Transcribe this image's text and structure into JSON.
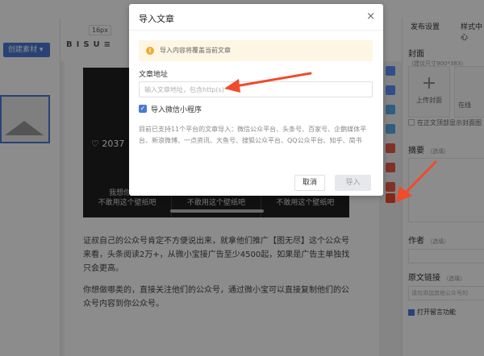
{
  "toolbar": {
    "create_material": "创建素材",
    "font_size": "16px",
    "format_icons": "BISU≡"
  },
  "editor": {
    "caption_top": [
      "我想你们都",
      "不敢用这个"
    ],
    "like_count": "2037",
    "col_caps": [
      [
        "我想你们都",
        "不敢用这个壁纸吧"
      ],
      [
        "我想你们都",
        "不敢用这个壁纸吧"
      ],
      [
        "我想你们都",
        "不敢用这个壁纸吧"
      ]
    ],
    "paragraph1": "证叔自己的公众号肯定不方便说出来，就拿他们推广【图无尽】这个公众号来看，头条阅读2万+，从微小宝接广告至少4500起，如果是广告主单独找只会更高。",
    "paragraph2": "你想做哪类的，直接关注他们的公众号，通过微小宝可以直接复制他们的公众号内容到你公众号。"
  },
  "right_panel": {
    "tab_publish": "发布设置",
    "tab_style": "样式中心",
    "cover_label": "封面",
    "cover_hint": "（建议尺寸900*383）",
    "upload_cover": "上传封面",
    "select_cover": "在线",
    "show_cover_text": "在正文顶部显示封面图",
    "summary_label": "摘要",
    "summary_hint": "（选填）",
    "author_label": "作者",
    "author_hint": "（选填）",
    "source_label": "原文链接",
    "source_hint": "（选填）",
    "source_placeholder": "请勿添加其他公众号的",
    "comment_label": "打开留言功能"
  },
  "modal": {
    "title": "导入文章",
    "close": "×",
    "warning": "导入内容将覆盖当前文章",
    "field_label": "文章地址",
    "field_placeholder": "输入文章地址，包含http(s)",
    "mini_program": "导入微信小程序",
    "support_text": "目前已支持11个平台的文章导入：微信公众平台、头条号、百家号、企鹅媒体平台、新浪微博、一点资讯、大鱼号、搜狐公众平台、QQ公众平台、知乎、简书",
    "cancel": "取消",
    "import": "导入"
  },
  "colors": {
    "accent": "#4a78d6",
    "arrow": "#f04b2a",
    "warning": "#f0ad34"
  }
}
